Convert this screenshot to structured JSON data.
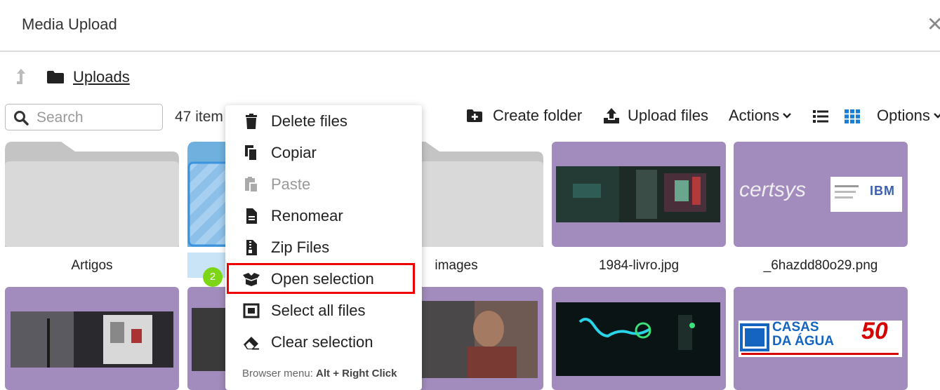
{
  "dialog": {
    "title": "Media Upload",
    "close_icon": "close-icon"
  },
  "breadcrumb": {
    "up_icon": "arrow-up-icon",
    "folder_icon": "folder-icon",
    "current": "Uploads"
  },
  "search": {
    "placeholder": "Search",
    "value": ""
  },
  "item_count": "47 item",
  "toolbar": {
    "create_folder": "Create folder",
    "upload_files": "Upload files",
    "actions": "Actions",
    "options": "Options",
    "list_view_icon": "list-icon",
    "grid_view_icon": "grid-icon",
    "active_view_color": "#1a7fd4"
  },
  "tiles": [
    {
      "name": "Artigos",
      "kind": "folder"
    },
    {
      "name": "",
      "kind": "folder-selected"
    },
    {
      "name": "images",
      "kind": "folder"
    },
    {
      "name": "1984-livro.jpg",
      "kind": "image"
    },
    {
      "name": "_6hazdd80o29.png",
      "kind": "image"
    }
  ],
  "image_text": {
    "certsys_logo": "certsys",
    "ibm_logo": "IBM",
    "casas_logo_line1": "CASAS",
    "casas_logo_line2": "DA ÁGUA",
    "casas_50": "50"
  },
  "context_menu": {
    "items": [
      {
        "label": "Delete files",
        "icon": "trash-icon",
        "disabled": false
      },
      {
        "label": "Copiar",
        "icon": "copy-icon",
        "disabled": false
      },
      {
        "label": "Paste",
        "icon": "paste-icon",
        "disabled": true
      },
      {
        "label": "Renomear",
        "icon": "file-text-icon",
        "disabled": false
      },
      {
        "label": "Zip Files",
        "icon": "zip-icon",
        "disabled": false
      },
      {
        "label": "Open selection",
        "icon": "box-open-icon",
        "disabled": false
      },
      {
        "label": "Select all files",
        "icon": "select-all-icon",
        "disabled": false
      },
      {
        "label": "Clear selection",
        "icon": "eraser-icon",
        "disabled": false
      }
    ],
    "hint_prefix": "Browser menu: ",
    "hint_shortcut": "Alt + Right Click"
  },
  "step_badge": "2",
  "colors": {
    "tile_purple": "#a18cbd",
    "folder_gray": "#d7d7d7",
    "selected_blue": "#6fb0de",
    "highlight": "#e00000",
    "badge_green": "#7cd616"
  }
}
